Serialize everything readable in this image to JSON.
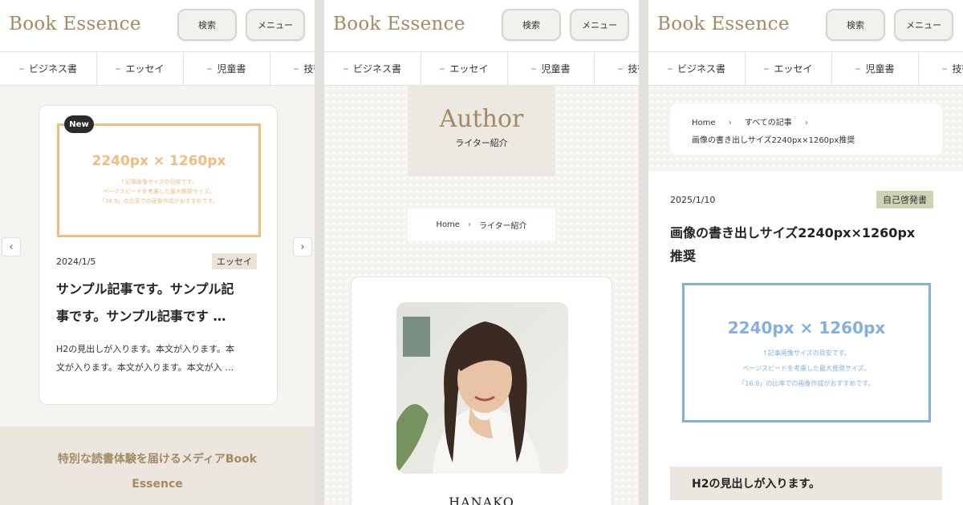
{
  "header": {
    "logo": "Book Essence",
    "search_label": "検索",
    "menu_label": "メニュー"
  },
  "categories": [
    "ビジネス書",
    "エッセイ",
    "児童書",
    "技術書"
  ],
  "panel1": {
    "card": {
      "new_badge": "New",
      "thumb_big": "2240px × 1260px",
      "thumb_lines": [
        "↑記事画像サイズの目安です。",
        "ページスピードを考慮した最大推奨サイズ。",
        "「16:9」の比率での画像作成がおすすめです。"
      ],
      "date": "2024/1/5",
      "tag": "エッセイ",
      "title_line1": "サンプル記事です。サンプル記",
      "title_line2": "事です。サンプル記事です …",
      "excerpt_line1": "H2の見出しが入ります。本文が入ります。本",
      "excerpt_line2": "文が入ります。本文が入ります。本文が入 …"
    },
    "prev_arrow": "‹",
    "next_arrow": "›",
    "footer_line1": "特別な読書体験を届けるメディアBook",
    "footer_line2": "Essence"
  },
  "panel2": {
    "hero_title": "Author",
    "hero_subtitle": "ライター紹介",
    "breadcrumb_home": "Home",
    "breadcrumb_sep": "›",
    "breadcrumb_current": "ライター紹介",
    "author_name": "HANAKO"
  },
  "panel3": {
    "breadcrumb_home": "Home",
    "breadcrumb_sep": "›",
    "breadcrumb_all": "すべての記事",
    "breadcrumb_current": "画像の書き出しサイズ2240px×1260px推奨",
    "date": "2025/1/10",
    "tag": "自己啓発書",
    "title_line1": "画像の書き出しサイズ2240px×1260px",
    "title_line2": "推奨",
    "thumb_big": "2240px × 1260px",
    "thumb_lines": [
      "↑記事画像サイズの目安です。",
      "ページスピードを考慮した最大推奨サイズ。",
      "「16:9」の比率での画像作成がおすすめです。"
    ],
    "h2": "H2の見出しが入ります。"
  },
  "colors": {
    "brand": "#a38a64",
    "thumb_orange": "#edbd82",
    "thumb_blue": "#85afe0",
    "tag_essay": "#ebe2d8",
    "tag_self": "#ccd4b3"
  }
}
